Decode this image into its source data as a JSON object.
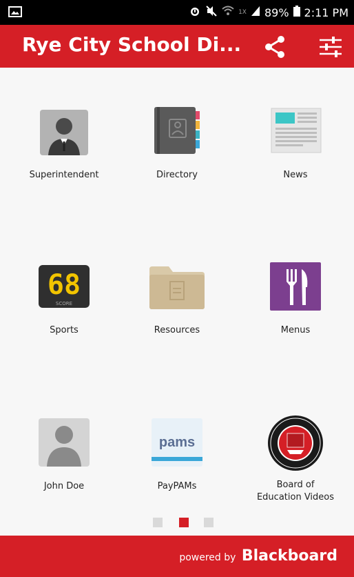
{
  "status_bar": {
    "signal_tag": "1X",
    "battery": "89%",
    "time": "2:11 PM"
  },
  "header": {
    "title": "Rye City School Di..."
  },
  "tiles": [
    {
      "label": "Superintendent",
      "icon": "superintendent-icon"
    },
    {
      "label": "Directory",
      "icon": "directory-icon"
    },
    {
      "label": "News",
      "icon": "news-icon"
    },
    {
      "label": "Sports",
      "icon": "sports-icon",
      "score": "68",
      "score_label": "SCORE"
    },
    {
      "label": "Resources",
      "icon": "resources-icon"
    },
    {
      "label": "Menus",
      "icon": "menus-icon"
    },
    {
      "label": "John Doe",
      "icon": "person-icon"
    },
    {
      "label": "PayPAMs",
      "icon": "pams-icon",
      "logo_text": "pams"
    },
    {
      "label": "Board of Education Videos",
      "icon": "seal-icon"
    }
  ],
  "pager": {
    "count": 3,
    "active_index": 1
  },
  "footer": {
    "powered_by": "powered by",
    "brand": "Blackboard"
  },
  "colors": {
    "primary": "#d51f26",
    "pager_inactive": "#d9d9d9",
    "menus_purple": "#7c3f8f"
  }
}
